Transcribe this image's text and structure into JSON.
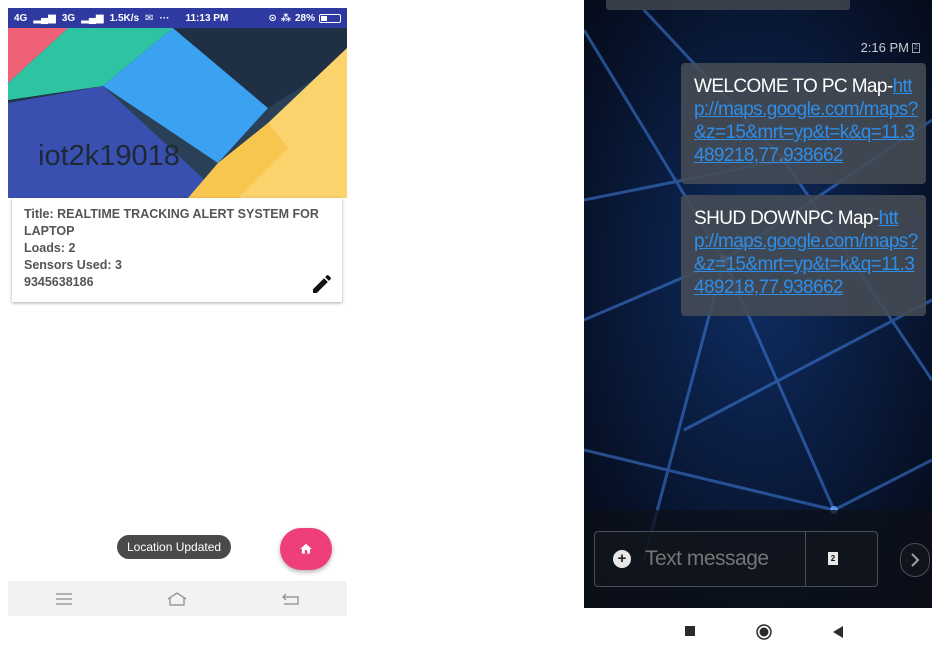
{
  "left_phone": {
    "status_bar": {
      "signal_1": "4G",
      "signal_2": "3G",
      "speed": "1.5K/s",
      "time": "11:13 PM",
      "battery": "28%"
    },
    "banner_title": "iot2k19018",
    "card": {
      "title": "Title: REALTIME TRACKING ALERT SYSTEM FOR LAPTOP",
      "loads": "Loads: 2",
      "sensors": "Sensors Used: 3",
      "phone": "9345638186",
      "edit_icon": "pencil-icon"
    },
    "toast": "Location Updated",
    "fab_icon": "home-icon",
    "nav_icons": [
      "menu-icon",
      "home-outline-icon",
      "back-icon"
    ],
    "colors": {
      "status_bar": "#2f3aa0",
      "fab": "#ef3f7b"
    }
  },
  "right_phone": {
    "time": "2:16 PM",
    "sim_badge": "2",
    "messages": [
      {
        "text": "WELCOME TO PC Map-",
        "link": "http://maps.google.com/maps?&z=15&mrt=yp&t=k&q=11.3489218,77.938662"
      },
      {
        "text": "SHUD DOWNPC Map-",
        "link": "http://maps.google.com/maps?&z=15&mrt=yp&t=k&q=11.3489218,77.938662"
      }
    ],
    "compose_placeholder": "Text message",
    "sim_button": "2",
    "nav_icons": [
      "square-icon",
      "circle-icon",
      "triangle-back-icon"
    ],
    "colors": {
      "link": "#2f8de8",
      "bubble": "#464c54"
    }
  }
}
